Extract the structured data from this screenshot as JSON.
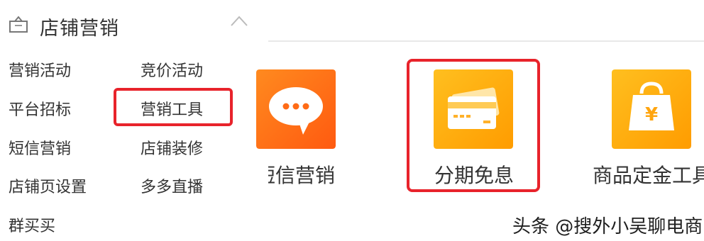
{
  "sidebar": {
    "title": "店铺营销",
    "icons": {
      "section": "store-icon",
      "toggle": "chevron-up-icon"
    },
    "items": [
      {
        "label": "营销活动"
      },
      {
        "label": "竞价活动"
      },
      {
        "label": "平台招标"
      },
      {
        "label": "营销工具"
      },
      {
        "label": "短信营销"
      },
      {
        "label": "店铺装修"
      },
      {
        "label": "店铺页设置"
      },
      {
        "label": "多多直播"
      },
      {
        "label": "群买买"
      }
    ]
  },
  "tools": [
    {
      "label": "短信营销",
      "icon": "chat-bubble-icon"
    },
    {
      "label": "分期免息",
      "icon": "credit-card-icon"
    },
    {
      "label": "商品定金工具",
      "icon": "shopping-bag-icon"
    }
  ],
  "colors": {
    "highlight": "#e8232b",
    "orange_start": "#ff8a1f",
    "orange_end": "#ff5a10",
    "yellow_start": "#ffbf1f",
    "yellow_end": "#ff9c00"
  },
  "watermark": "头条 @搜外小吴聊电商"
}
